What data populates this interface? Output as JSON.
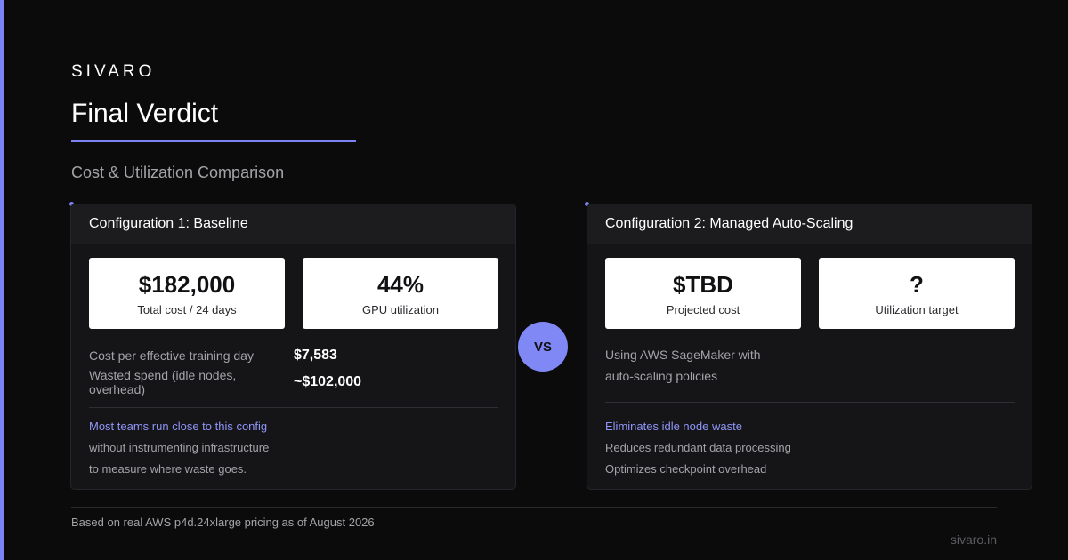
{
  "brand": "SIVARO",
  "title": "Final Verdict",
  "subtitle": "Cost & Utilization Comparison",
  "colors": {
    "accent": "#7c83f5",
    "background": "#0b0b0c",
    "card": "#151517"
  },
  "config1": {
    "heading": "Configuration 1: Baseline",
    "stats": [
      {
        "value": "$182,000",
        "label": "Total cost / 24 days"
      },
      {
        "value": "44%",
        "label": "GPU utilization"
      }
    ],
    "metrics": [
      {
        "label": "Cost per effective training day",
        "value": "$7,583"
      },
      {
        "label": "Wasted spend (idle nodes, overhead)",
        "value": "~$102,000"
      }
    ],
    "notes": [
      "Most teams run close to this config",
      "without instrumenting infrastructure",
      "to measure where waste goes."
    ]
  },
  "vs_label": "VS",
  "config2": {
    "heading": "Configuration 2: Managed Auto-Scaling",
    "stats": [
      {
        "value": "$TBD",
        "label": "Projected cost"
      },
      {
        "value": "?",
        "label": "Utilization target"
      }
    ],
    "description": [
      "Using AWS SageMaker with",
      "auto-scaling policies"
    ],
    "notes": [
      "Eliminates idle node waste",
      "Reduces redundant data processing",
      "Optimizes checkpoint overhead"
    ]
  },
  "footer": {
    "note": "Based on real AWS p4d.24xlarge pricing as of August 2026",
    "site": "sivaro.in"
  }
}
